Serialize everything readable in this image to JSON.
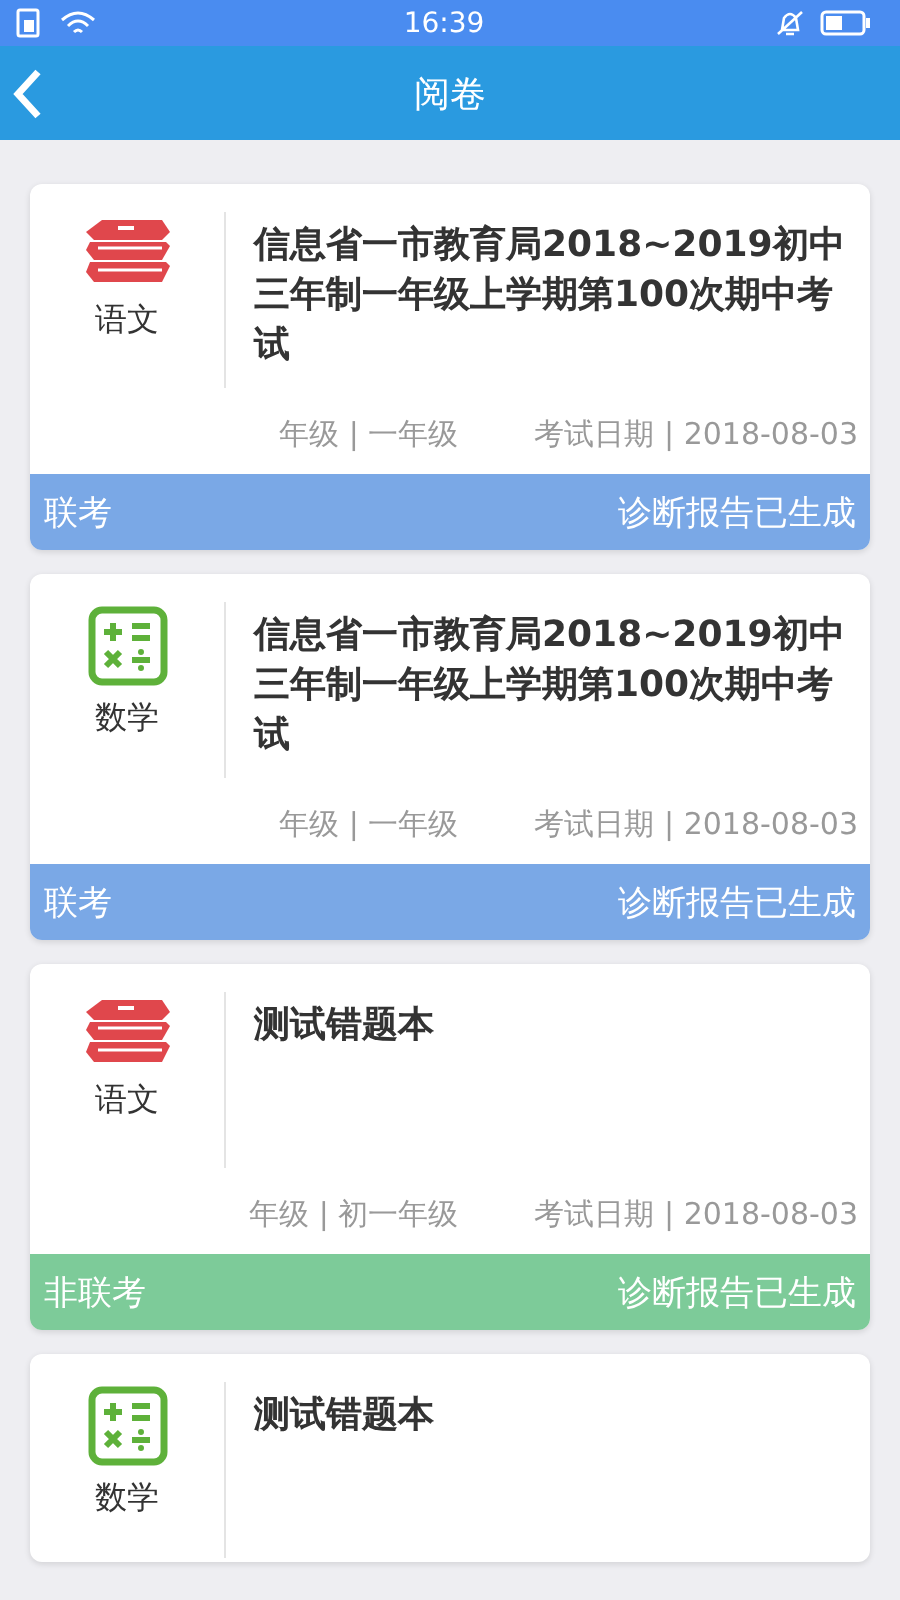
{
  "status_bar": {
    "time": "16:39"
  },
  "header": {
    "title": "阅卷"
  },
  "exams": [
    {
      "subject": "语文",
      "kind": "chinese",
      "title": "信息省一市教育局2018~2019初中三年制一年级上学期第100次期中考试",
      "grade": "年级 | 一年级",
      "date": "考试日期 | 2018-08-03",
      "footer": {
        "type": "联考",
        "status": "诊断报告已生成",
        "color": "#7aa8e6"
      }
    },
    {
      "subject": "数学",
      "kind": "math",
      "title": "信息省一市教育局2018~2019初中三年制一年级上学期第100次期中考试",
      "grade": "年级 | 一年级",
      "date": "考试日期 | 2018-08-03",
      "footer": {
        "type": "联考",
        "status": "诊断报告已生成",
        "color": "#7aa8e6"
      }
    },
    {
      "subject": "语文",
      "kind": "chinese",
      "title": "测试错题本",
      "grade": "年级 | 初一年级",
      "date": "考试日期 | 2018-08-03",
      "footer": {
        "type": "非联考",
        "status": "诊断报告已生成",
        "color": "#7dcb99"
      }
    },
    {
      "subject": "数学",
      "kind": "math",
      "title": "测试错题本"
    }
  ]
}
